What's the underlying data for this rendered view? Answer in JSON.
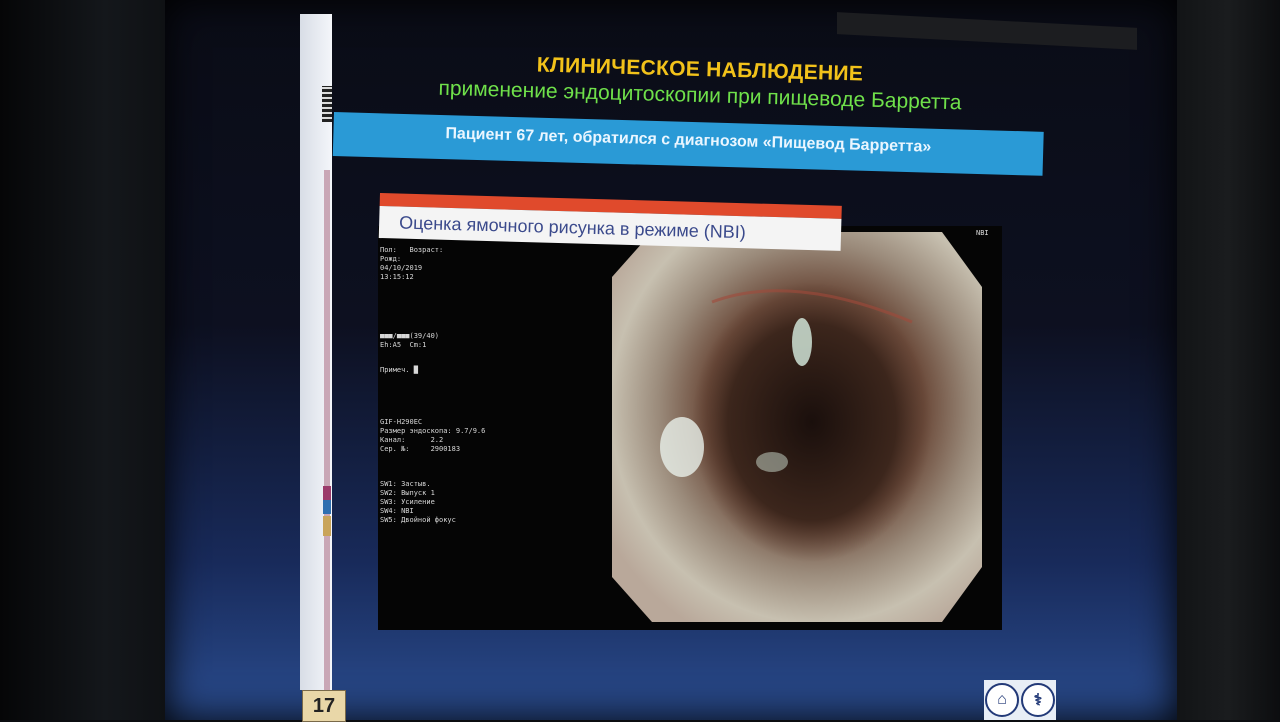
{
  "slide": {
    "title": "КЛИНИЧЕСКОЕ НАБЛЮДЕНИЕ",
    "subtitle": "применение эндоцитоскопии при пищеводе Барретта",
    "band_text": "Пациент 67 лет, обратился с диагнозом «Пищевод Барретта»",
    "nbi_label": "Оценка ямочного рисунка в режиме (NBI)",
    "page_number": "17",
    "colors": {
      "title": "#f2c21a",
      "subtitle": "#6fe04a",
      "band": "#2a9ad6",
      "label_bar": "#e04a2c"
    }
  },
  "endoscope": {
    "patient_lines": [
      "Пол:   Возраст:",
      "Рожд:",
      "04/10/2019",
      "13:15:12"
    ],
    "status_lines": [
      "■■■/■■■(39/40)",
      "Eh:A5  Cm:1"
    ],
    "comment_line": "Примеч. █",
    "device_lines": [
      "GIF-H290EC",
      "Размер эндоскопа: 9.7/9.6",
      "Канал:      2.2",
      "Сер. №:     2900183"
    ],
    "sw_lines": [
      "SW1: Застыв.",
      "SW2: Выпуск 1",
      "SW3: Усиление",
      "SW4: NBI",
      "SW5: Двойной фокус"
    ],
    "mode_tag": "NBI"
  },
  "icons": {
    "logo_left": "clinic-logo-icon",
    "logo_right": "caduceus-logo-icon"
  }
}
